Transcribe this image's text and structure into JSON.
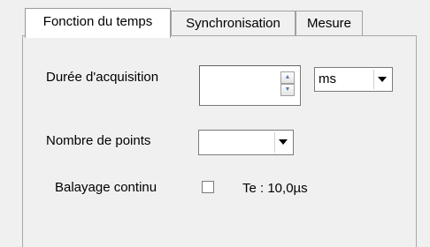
{
  "tabs": [
    {
      "label": "Fonction du temps",
      "active": true
    },
    {
      "label": "Synchronisation",
      "active": false
    },
    {
      "label": "Mesure",
      "active": false
    }
  ],
  "form": {
    "duree_label": "Durée d'acquisition",
    "duree_value": "",
    "unit_value": "ms",
    "points_label": "Nombre de points",
    "points_value": "",
    "balayage_label": "Balayage continu",
    "balayage_checked": false,
    "te_text": "Te : 10,0µs"
  },
  "icons": {
    "spin_up": "spin-up-arrow-icon",
    "spin_down": "spin-down-arrow-icon",
    "dropdown": "chevron-down-icon"
  }
}
